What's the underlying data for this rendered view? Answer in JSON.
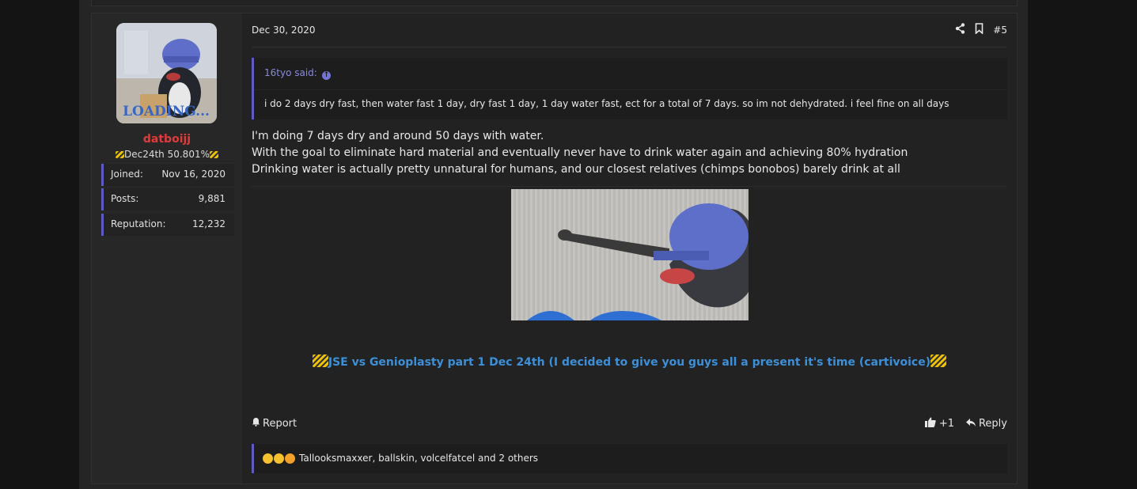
{
  "user": {
    "avatar_caption": "LOADING...",
    "username": "datboijj",
    "title": "Dec24th 50.801%",
    "stats": [
      {
        "label": "Joined:",
        "value": "Nov 16, 2020"
      },
      {
        "label": "Posts:",
        "value": "9,881"
      },
      {
        "label": "Reputation:",
        "value": "12,232"
      }
    ]
  },
  "post": {
    "date": "Dec 30, 2020",
    "number": "#5",
    "quote": {
      "author": "16tyo said:",
      "text": "i do 2 days dry fast, then water fast 1 day, dry fast 1 day, 1 day water fast, ect for a total of 7 days. so im not dehydrated. i feel fine on all days"
    },
    "body": [
      "I'm doing 7 days dry and around 50 days with water.",
      "With the goal to eliminate hard material and eventually never have to drink water again and achieving 80% hydration",
      "Drinking water is actually pretty unnatural for humans, and our closest relatives (chimps bonobos) barely drink at all"
    ],
    "signature_link": "JSE vs Genioplasty part 1 Dec 24th (I decided to give you guys all a present it's time (cartivoice)",
    "report_label": "Report",
    "like_count": "+1",
    "reply_label": "Reply",
    "reactions_text": "Tallooksmaxxer, ballskin, volcelfatcel and 2 others"
  },
  "colors": {
    "accent": "#5c5cc7",
    "username": "#e03a3a",
    "link": "#3d8fd8"
  },
  "icons": [
    "share-icon",
    "bookmark-icon",
    "arrow-up-circle-icon",
    "bell-icon",
    "thumbs-up-icon",
    "reply-icon",
    "construction-cone-icon"
  ]
}
